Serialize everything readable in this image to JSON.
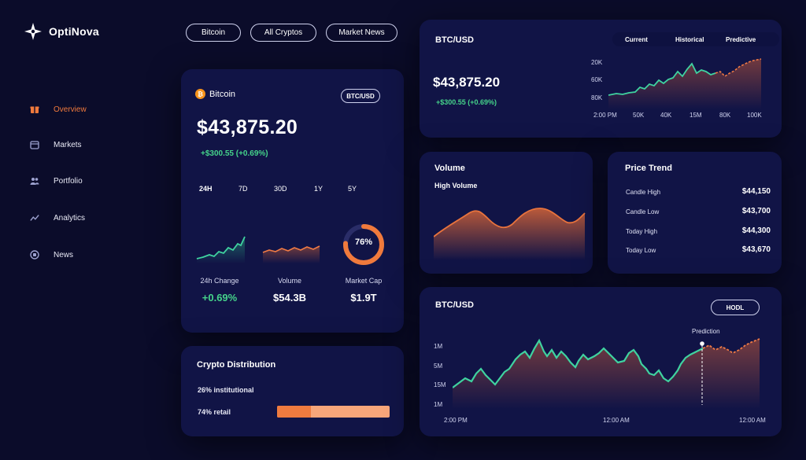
{
  "brand": {
    "name": "OptiNova"
  },
  "sidebar": {
    "items": [
      {
        "label": "Overview",
        "icon": "gift-icon",
        "active": true
      },
      {
        "label": "Markets",
        "icon": "calendar-icon",
        "active": false
      },
      {
        "label": "Portfolio",
        "icon": "users-icon",
        "active": false
      },
      {
        "label": "Analytics",
        "icon": "trend-icon",
        "active": false
      },
      {
        "label": "News",
        "icon": "news-icon",
        "active": false
      }
    ]
  },
  "top_tabs": [
    "Bitcoin",
    "All Cryptos",
    "Market News"
  ],
  "coin_card": {
    "coin": "Bitcoin",
    "pair": "BTC/USD",
    "price": "$43,875.20",
    "change": "+$300.55 (+0.69%)",
    "ranges": [
      "24H",
      "7D",
      "30D",
      "1Y",
      "5Y"
    ],
    "selected_range": "24H",
    "stats": [
      {
        "label": "24h Change",
        "value": "+0.69%"
      },
      {
        "label": "Volume",
        "value": "$54.3B"
      },
      {
        "label": "Market Cap",
        "value": "$1.9T"
      }
    ],
    "market_cap_ring": {
      "label": "76%",
      "fraction": 0.76
    }
  },
  "distribution": {
    "title": "Crypto Distribution",
    "institutional_label": "26% institutional",
    "retail_label": "74% retail"
  },
  "btc_card": {
    "title": "BTC/USD",
    "price": "$43,875.20",
    "change": "+$300.55 (+0.69%)",
    "tabs": [
      "Current",
      "Historical",
      "Predictive"
    ],
    "y_ticks": [
      "20K",
      "60K",
      "80K"
    ],
    "x_ticks": [
      "2:00 PM",
      "50K",
      "40K",
      "15M",
      "80K",
      "100K"
    ]
  },
  "volume_card": {
    "title": "Volume",
    "subtitle": "High Volume"
  },
  "trend_card": {
    "title": "Price Trend",
    "rows": [
      {
        "label": "Candle High",
        "value": "$44,150"
      },
      {
        "label": "Candle Low",
        "value": "$43,700"
      },
      {
        "label": "Today High",
        "value": "$44,300"
      },
      {
        "label": "Today Low",
        "value": "$43,670"
      }
    ]
  },
  "prediction_card": {
    "title": "BTC/USD",
    "button": "HODL",
    "marker_label": "Prediction",
    "y_ticks": [
      "1M",
      "5M",
      "15M",
      "1M"
    ],
    "x_ticks": [
      "2:00 PM",
      "12:00 AM",
      "12:00 AM"
    ]
  },
  "colors": {
    "background": "#0b0c2a",
    "card": "#111446",
    "accent_orange": "#f07a3c",
    "accent_green": "#45d38a"
  }
}
